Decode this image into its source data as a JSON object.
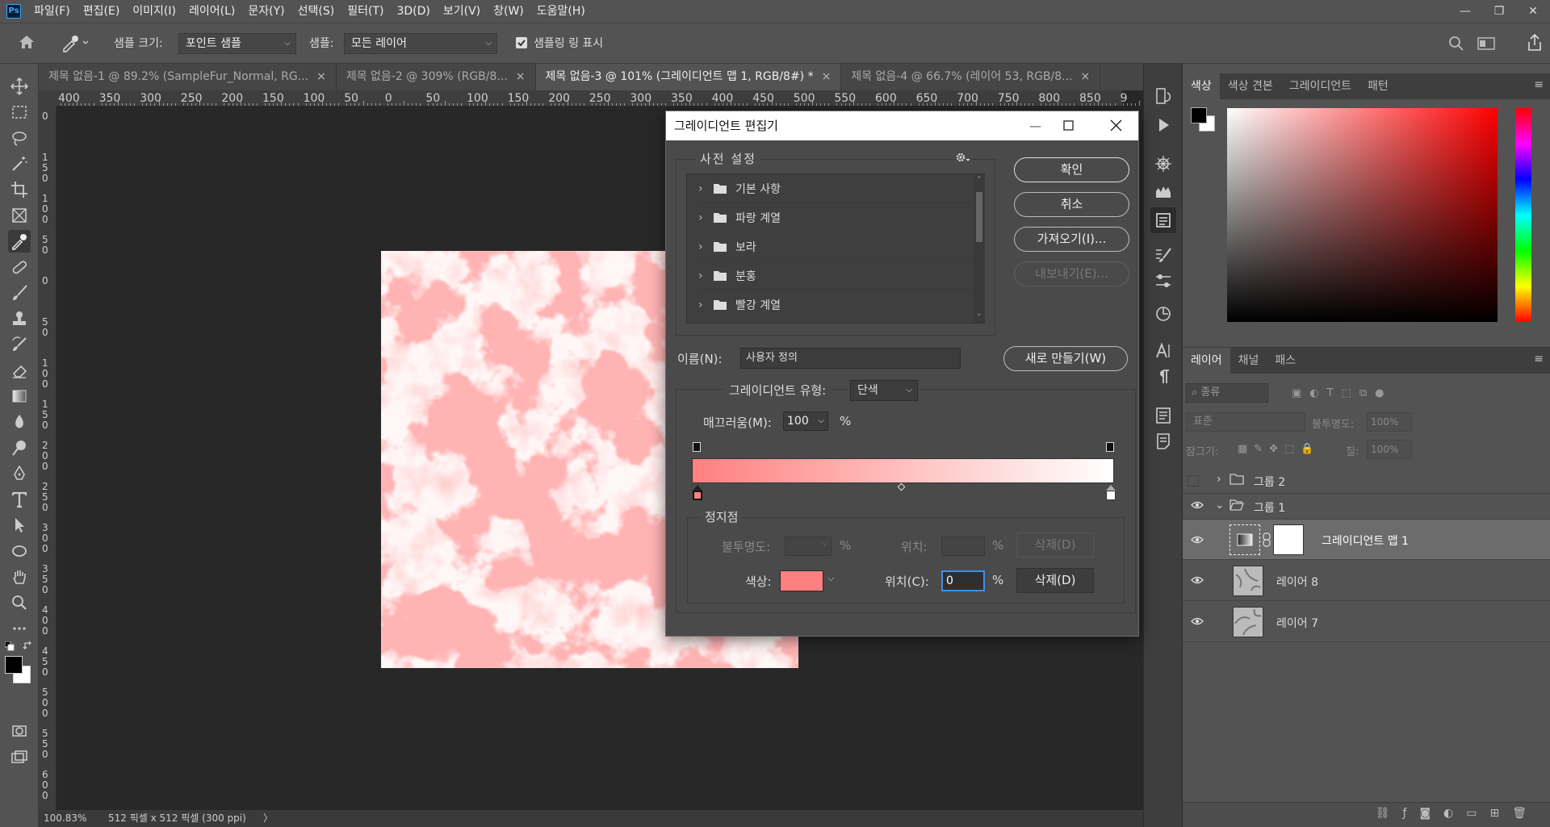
{
  "app": {
    "logo": "Ps",
    "menu": [
      "파일(F)",
      "편집(E)",
      "이미지(I)",
      "레이어(L)",
      "문자(Y)",
      "선택(S)",
      "필터(T)",
      "3D(D)",
      "보기(V)",
      "창(W)",
      "도움말(H)"
    ],
    "window_controls": [
      "—",
      "❐",
      "✕"
    ]
  },
  "options_bar": {
    "sample_size_label": "샘플 크기:",
    "sample_size_value": "포인트 샘플",
    "sample_label": "샘플:",
    "sample_value": "모든 레이어",
    "show_ring_label": "샘플링 링 표시",
    "show_ring_checked": true
  },
  "tabs": [
    {
      "label": "제목 없음-1 @ 89.2% (SampleFur_Normal, RG...",
      "close": "×",
      "active": false
    },
    {
      "label": "제목 없음-2 @ 309% (RGB/8...",
      "close": "×",
      "active": false
    },
    {
      "label": "제목 없음-3 @ 101% (그레이디언트 맵 1, RGB/8#) *",
      "close": "×",
      "active": true
    },
    {
      "label": "제목 없음-4 @ 66.7% (레이어 53, RGB/8...",
      "close": "×",
      "active": false
    }
  ],
  "ruler": {
    "top_ticks": [
      "400",
      "350",
      "300",
      "250",
      "200",
      "150",
      "100",
      "50",
      "0",
      "50",
      "100",
      "150",
      "200",
      "250",
      "300",
      "350",
      "400",
      "450",
      "500",
      "550",
      "600",
      "650",
      "700",
      "750",
      "800",
      "850",
      "9"
    ],
    "left_labels": [
      "0",
      "150",
      "100",
      "50",
      "0",
      "50",
      "100",
      "150",
      "200",
      "250",
      "300",
      "350",
      "400",
      "450",
      "500",
      "550",
      "600"
    ]
  },
  "status": {
    "zoom": "100.83%",
    "doc_info": "512 픽셀 x 512 픽셀 (300 ppi)",
    "arrow": "〉"
  },
  "dialog": {
    "title": "그레이디언트 편집기",
    "presets_label": "사전 설정",
    "presets": [
      "기본 사항",
      "파랑 계열",
      "보라",
      "분홍",
      "빨강 계열"
    ],
    "buttons": {
      "ok": "확인",
      "cancel": "취소",
      "import": "가져오기(I)...",
      "export": "내보내기(E)...",
      "new": "새로 만들기(W)"
    },
    "name_label": "이름(N):",
    "name_value": "사용자 정의",
    "type_label": "그레이디언트 유형:",
    "type_value": "단색",
    "smoothness_label": "매끄러움(M):",
    "smoothness_value": "100",
    "percent": "%",
    "stops_label": "정지점",
    "opacity_label": "불투명도:",
    "location_label": "위치:",
    "delete_label": "삭제(D)",
    "color_label": "색상:",
    "location_c_label": "위치(C):",
    "location_c_value": "0",
    "gradient_start": "#ff8080",
    "gradient_end": "#ffffff"
  },
  "color_panel": {
    "tabs": [
      "색상",
      "색상 견본",
      "그레이디언트",
      "패턴"
    ],
    "foreground": "#000000",
    "background": "#ffffff"
  },
  "layers_panel": {
    "tabs": [
      "레이어",
      "채널",
      "패스"
    ],
    "filter_placeholder": "종류",
    "blend_mode": "표준",
    "opacity_label": "불투명도:",
    "opacity_value": "100%",
    "lock_label": "잠그기:",
    "fill_label": "칠:",
    "fill_value": "100%",
    "layers": [
      {
        "name": "그룹 2",
        "type": "group"
      },
      {
        "name": "그룹 1",
        "type": "group-open"
      },
      {
        "name": "그레이디언트 맵 1",
        "type": "adjustment"
      },
      {
        "name": "레이어 8",
        "type": "pixel"
      },
      {
        "name": "레이어 7",
        "type": "pixel"
      }
    ]
  }
}
